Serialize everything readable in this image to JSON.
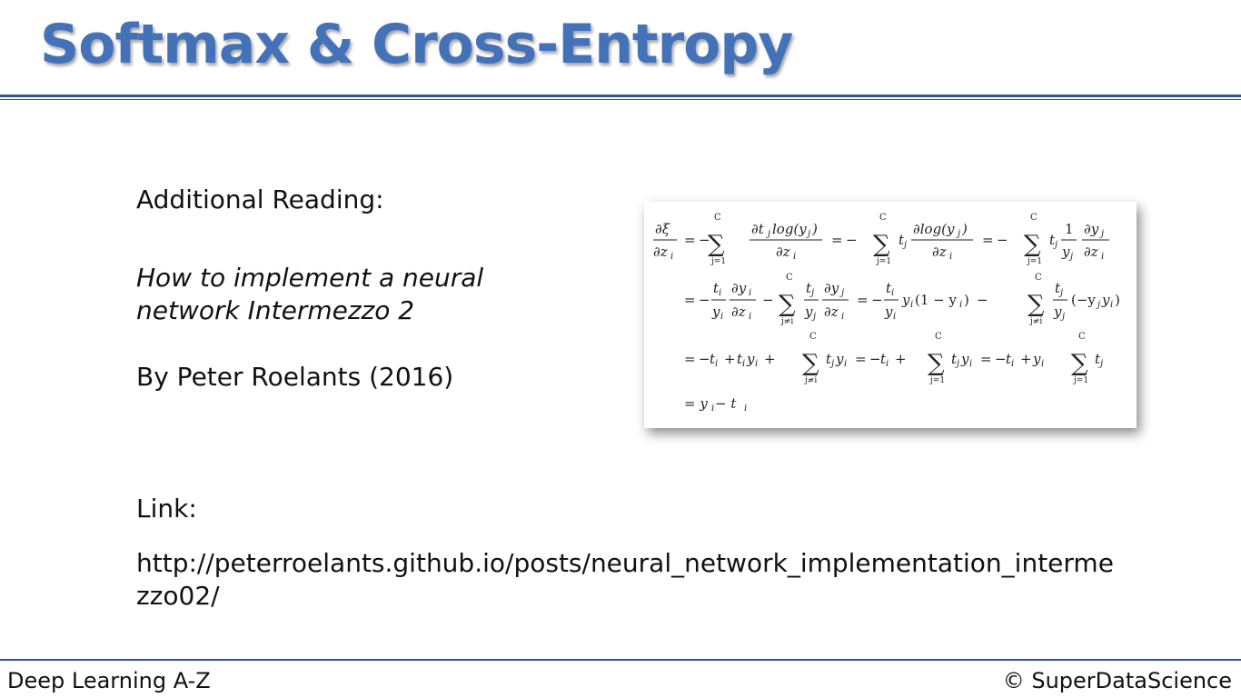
{
  "slide": {
    "title": "Softmax & Cross-Entropy",
    "heading": "Additional Reading:",
    "article_title_line1": "How to implement a neural",
    "article_title_line2": "network Intermezzo 2",
    "author": "By Peter Roelants (2016)",
    "link_label": "Link:",
    "link_url": "http://peterroelants.github.io/posts/neural_network_implementation_intermezzo02/"
  },
  "footer": {
    "course": "Deep Learning A-Z",
    "copyright": "© SuperDataScience"
  },
  "formula": {
    "lhs_num": "∂ξ",
    "lhs_den": "∂z",
    "sub_i": "i",
    "sub_j": "j",
    "sum": "∑",
    "upper": "C",
    "lower_j1": "j=1",
    "lower_jni": "j≠i",
    "eq": "=",
    "minus": "−",
    "plus": "+",
    "l1_t1_num": "∂t",
    "l1_t1_log": "log(y",
    "l1_t1_close": ")",
    "l1_t2_num": "∂log(y",
    "l1_t2_close": ")",
    "l1_t3_num": "1",
    "l1_t3b_num": "∂y",
    "y": "y",
    "t": "t",
    "dz": "∂z",
    "dy": "∂y",
    "paren_1my": "(1 − y",
    "paren_close": ")",
    "neg_yy": "(−y",
    "result": "= y",
    "result_minus_t": " − t"
  },
  "colors": {
    "title": "#4472b8",
    "rule": "#2f5597"
  }
}
